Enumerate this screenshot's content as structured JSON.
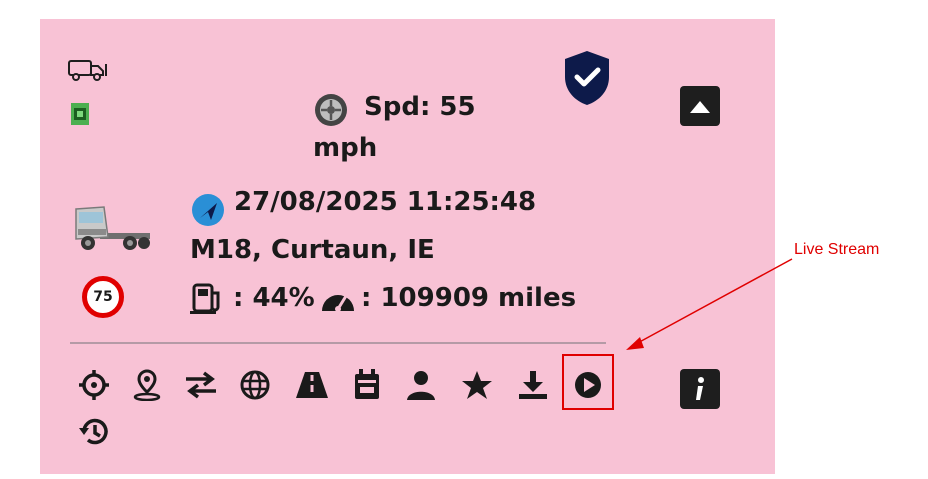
{
  "vehicle": {
    "speed_label": "Spd: 55",
    "speed_unit": "mph",
    "timestamp": "27/08/2025 11:25:48",
    "location": "M18, Curtaun, IE",
    "fuel": ": 44%",
    "odometer": ": 109909 miles",
    "speed_limit": "75"
  },
  "toolbar": {
    "icons": [
      "crosshair-icon",
      "location-pin-icon",
      "swap-arrows-icon",
      "globe-icon",
      "road-icon",
      "calendar-icon",
      "user-icon",
      "star-icon",
      "download-icon",
      "play-circle-icon",
      "history-icon"
    ]
  },
  "annotation": {
    "text": "Live Stream",
    "color": "#e00000"
  },
  "colors": {
    "card_bg": "#f8c2d5",
    "shield": "#0d1a4a",
    "dark_button": "#1e1e1e"
  }
}
